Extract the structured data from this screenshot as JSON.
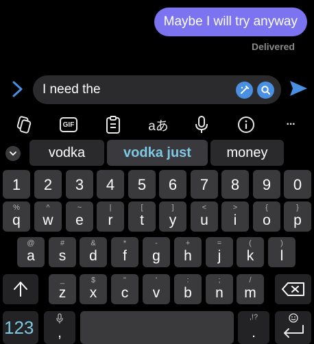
{
  "conversation": {
    "last_message": "Maybe I will try anyway",
    "status": "Delivered"
  },
  "composer": {
    "text": "I need the",
    "expand_icon": "chevron-right-icon",
    "icons": [
      "magic-pen-icon",
      "search-icon"
    ],
    "send_icon": "send-icon"
  },
  "toolbar": {
    "items": [
      "clipboard-copy-icon",
      "gif-icon",
      "clipboard-icon",
      "translate-icon",
      "microphone-icon",
      "info-icon",
      "more-icon"
    ],
    "gif_label": "GIF",
    "translate_label": "aあ",
    "more_label": "···"
  },
  "suggestions": {
    "items": [
      "vodka",
      "vodka just",
      "money"
    ]
  },
  "keyboard": {
    "numbers": [
      "1",
      "2",
      "3",
      "4",
      "5",
      "6",
      "7",
      "8",
      "9",
      "0"
    ],
    "row1": [
      {
        "key": "q",
        "hint": "%"
      },
      {
        "key": "w",
        "hint": "^"
      },
      {
        "key": "e",
        "hint": "~"
      },
      {
        "key": "r",
        "hint": "|"
      },
      {
        "key": "t",
        "hint": "["
      },
      {
        "key": "y",
        "hint": "]"
      },
      {
        "key": "u",
        "hint": "<"
      },
      {
        "key": "i",
        "hint": ">"
      },
      {
        "key": "o",
        "hint": "{"
      },
      {
        "key": "p",
        "hint": "}"
      }
    ],
    "row2": [
      {
        "key": "a",
        "hint": "@"
      },
      {
        "key": "s",
        "hint": "#"
      },
      {
        "key": "d",
        "hint": "&"
      },
      {
        "key": "f",
        "hint": "*"
      },
      {
        "key": "g",
        "hint": "-"
      },
      {
        "key": "h",
        "hint": "+"
      },
      {
        "key": "j",
        "hint": "="
      },
      {
        "key": "k",
        "hint": "("
      },
      {
        "key": "l",
        "hint": ")"
      }
    ],
    "row3": [
      {
        "key": "z",
        "hint": "_"
      },
      {
        "key": "x",
        "hint": "$"
      },
      {
        "key": "c",
        "hint": "\""
      },
      {
        "key": "v",
        "hint": "'"
      },
      {
        "key": "b",
        "hint": ":"
      },
      {
        "key": "n",
        "hint": ";"
      },
      {
        "key": "m",
        "hint": "/"
      }
    ],
    "symbols_label": "123",
    "comma_label": ",",
    "period_label": ".",
    "period_hint": ",!?",
    "shift_icon": "shift-icon",
    "backspace_icon": "backspace-icon",
    "mic_icon": "microphone-icon",
    "emoji_icon": "emoji-icon",
    "enter_icon": "enter-icon"
  }
}
